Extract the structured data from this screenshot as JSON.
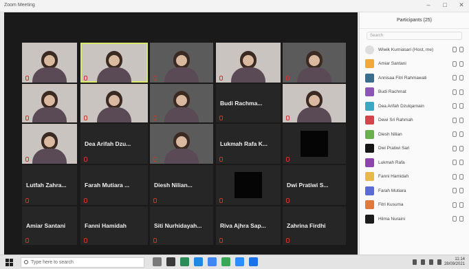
{
  "window": {
    "title": "Zoom Meeting"
  },
  "meeting": {
    "tiles": [
      {
        "type": "video",
        "name": ""
      },
      {
        "type": "video",
        "name": ""
      },
      {
        "type": "video",
        "name": ""
      },
      {
        "type": "video",
        "name": ""
      },
      {
        "type": "video",
        "name": ""
      },
      {
        "type": "video",
        "name": ""
      },
      {
        "type": "video",
        "name": ""
      },
      {
        "type": "video",
        "name": ""
      },
      {
        "type": "name",
        "name": "Budi Rachma..."
      },
      {
        "type": "video",
        "name": ""
      },
      {
        "type": "video",
        "name": ""
      },
      {
        "type": "name",
        "name": "Dea Arifah Dzu..."
      },
      {
        "type": "video",
        "name": ""
      },
      {
        "type": "name",
        "name": "Lukmah Rafa K..."
      },
      {
        "type": "black",
        "name": ""
      },
      {
        "type": "name",
        "name": "Lutfah Zahra..."
      },
      {
        "type": "name",
        "name": "Farah Mutiara ..."
      },
      {
        "type": "name",
        "name": "Diesh Nilian..."
      },
      {
        "type": "black",
        "name": ""
      },
      {
        "type": "name",
        "name": "Dwi Pratiwi S..."
      },
      {
        "type": "name",
        "name": "Amiar Santani"
      },
      {
        "type": "name",
        "name": "Fanni Hamidah"
      },
      {
        "type": "name",
        "name": "Siti Nurhidayah..."
      },
      {
        "type": "name",
        "name": "Riva Ajhra Sap..."
      },
      {
        "type": "name",
        "name": "Zahrina Firdhi"
      }
    ]
  },
  "participants": {
    "header": "Participants (25)",
    "search_placeholder": "Search",
    "list": [
      {
        "name": "Wiwik Kurniasari (Host, me)",
        "color": "#dedede"
      },
      {
        "name": "Amiar Santani",
        "color": "#f2a93b"
      },
      {
        "name": "Annisaa Fitri Rahmawati",
        "color": "#3a6e8f"
      },
      {
        "name": "Budi Rachmat",
        "color": "#8e55b8"
      },
      {
        "name": "Dea Arifah Dzulqarnain",
        "color": "#3aa7c4"
      },
      {
        "name": "Dewi Sri Rahmah",
        "color": "#d4444a"
      },
      {
        "name": "Diesh Nilian",
        "color": "#6ab04c"
      },
      {
        "name": "Dwi Pratiwi Sari",
        "color": "#151515"
      },
      {
        "name": "Lukmah Rafa",
        "color": "#8e44ad"
      },
      {
        "name": "Fanni Hamidah",
        "color": "#e8b84a"
      },
      {
        "name": "Farah Mutiara",
        "color": "#5a6bd6"
      },
      {
        "name": "Fitri Kusuma",
        "color": "#e0793a"
      },
      {
        "name": "Hilma Nuraini",
        "color": "#1b1b1b"
      }
    ]
  },
  "taskbar": {
    "search_placeholder": "Type here to search",
    "time": "11:14",
    "date": "28/09/2021",
    "app_colors": [
      "#7a7a7a",
      "#3a3a3a",
      "#2e8b57",
      "#1e88e5",
      "#4285f4",
      "#3aa757",
      "#2d8cff",
      "#1a73e8"
    ]
  }
}
